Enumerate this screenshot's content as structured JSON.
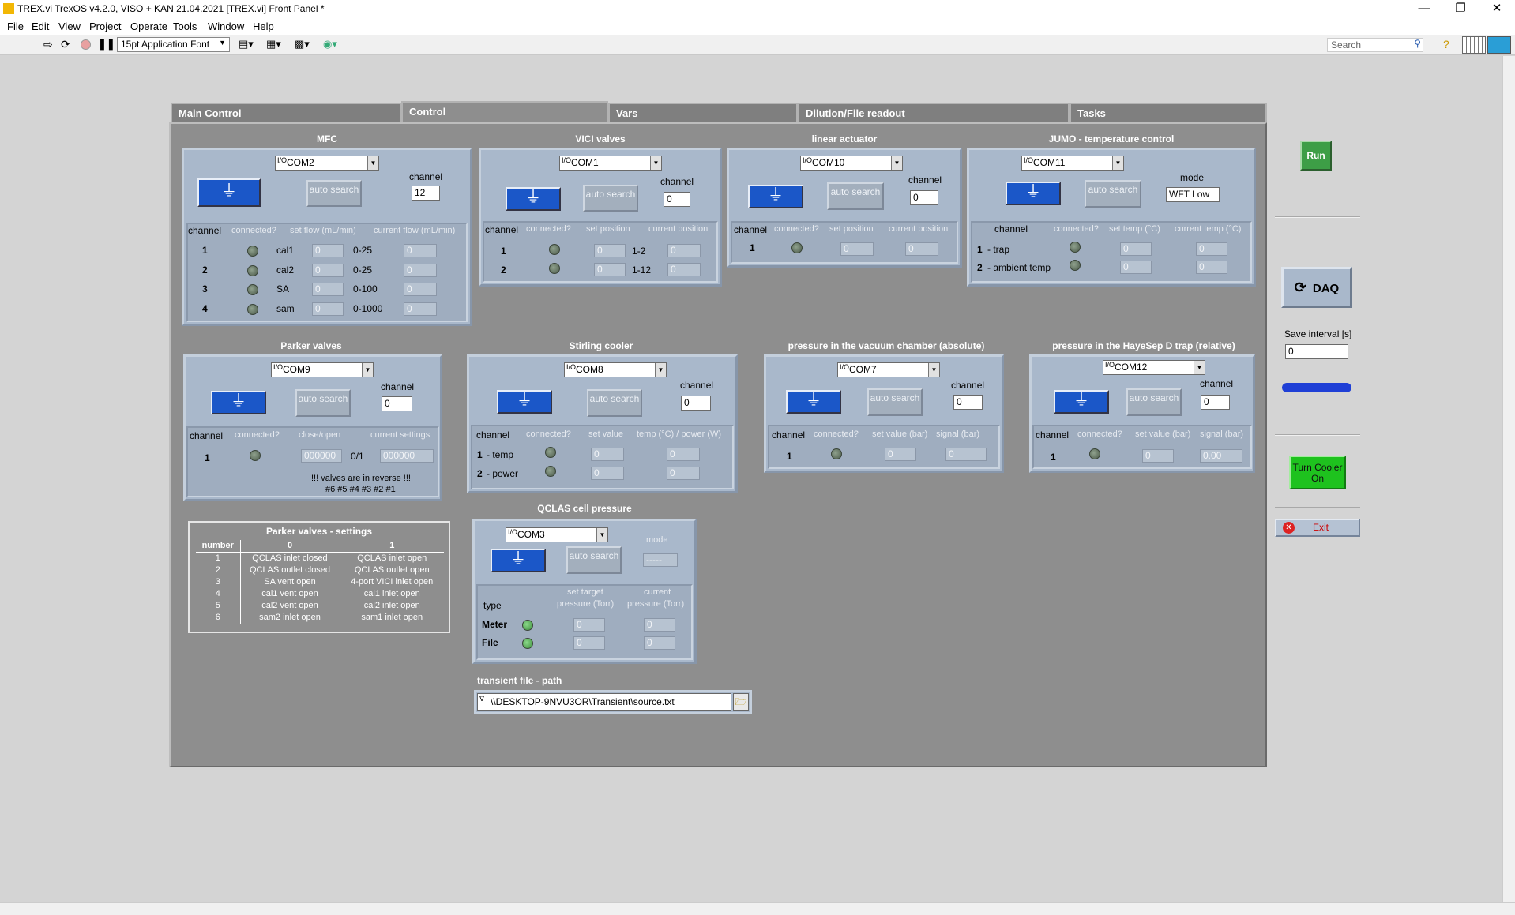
{
  "window": {
    "title": "TREX.vi TrexOS v4.2.0, VISO + KAN 21.04.2021 [TREX.vi] Front Panel *"
  },
  "menu": [
    "File",
    "Edit",
    "View",
    "Project",
    "Operate",
    "Tools",
    "Window",
    "Help"
  ],
  "toolbar": {
    "font": "15pt Application Font",
    "search_placeholder": "Search"
  },
  "tabs": [
    "Main Control",
    "Control",
    "Vars",
    "Dilution/File readout",
    "Tasks"
  ],
  "common": {
    "auto_search": "auto search",
    "channel": "channel",
    "connected": "connected?",
    "mode": "mode",
    "type": "type"
  },
  "mfc": {
    "title": "MFC",
    "port": "COM2",
    "channel_value": "12",
    "hdr_set": "set flow (mL/min)",
    "hdr_cur": "current flow (mL/min)",
    "rows": [
      {
        "ch": "1",
        "name": "cal1",
        "set": "0",
        "range": "0-25",
        "cur": "0"
      },
      {
        "ch": "2",
        "name": "cal2",
        "set": "0",
        "range": "0-25",
        "cur": "0"
      },
      {
        "ch": "3",
        "name": "SA",
        "set": "0",
        "range": "0-100",
        "cur": "0"
      },
      {
        "ch": "4",
        "name": "sam",
        "set": "0",
        "range": "0-1000",
        "cur": "0"
      }
    ]
  },
  "vici": {
    "title": "VICI valves",
    "port": "COM1",
    "channel_value": "0",
    "hdr_set": "set position",
    "hdr_cur": "current position",
    "rows": [
      {
        "ch": "1",
        "set": "0",
        "range": "1-2",
        "cur": "0"
      },
      {
        "ch": "2",
        "set": "0",
        "range": "1-12",
        "cur": "0"
      }
    ]
  },
  "actuator": {
    "title": "linear actuator",
    "port": "COM10",
    "channel_value": "0",
    "hdr_set": "set position",
    "hdr_cur": "current position",
    "rows": [
      {
        "ch": "1",
        "set": "0",
        "cur": "0"
      }
    ]
  },
  "jumo": {
    "title": "JUMO - temperature control",
    "port": "COM11",
    "mode_value": "WFT Low",
    "hdr_set": "set temp (°C)",
    "hdr_cur": "current temp (°C)",
    "rows": [
      {
        "ch": "1",
        "name": "- trap",
        "set": "0",
        "cur": "0"
      },
      {
        "ch": "2",
        "name": "- ambient temp",
        "set": "0",
        "cur": "0"
      }
    ]
  },
  "parker": {
    "title": "Parker valves",
    "port": "COM9",
    "channel_value": "0",
    "hdr_close": "close/open",
    "hdr_cur": "current settings",
    "row": {
      "ch": "1",
      "value": "000000",
      "range": "0/1",
      "cur": "000000"
    },
    "note1": "!!! valves are in reverse !!!",
    "note2": "#6 #5 #4 #3 #2 #1"
  },
  "stirling": {
    "title": "Stirling cooler",
    "port": "COM8",
    "channel_value": "0",
    "hdr_set": "set value",
    "hdr_cur": "temp (°C) / power (W)",
    "rows": [
      {
        "ch": "1",
        "name": "- temp",
        "set": "0",
        "cur": "0"
      },
      {
        "ch": "2",
        "name": "- power",
        "set": "0",
        "cur": "0"
      }
    ]
  },
  "vacuum": {
    "title": "pressure in the vacuum chamber (absolute)",
    "port": "COM7",
    "channel_value": "0",
    "hdr_set": "set value (bar)",
    "hdr_cur": "signal (bar)",
    "row": {
      "ch": "1",
      "set": "0",
      "cur": "0"
    }
  },
  "hayesep": {
    "title": "pressure in the HayeSep D trap (relative)",
    "port": "COM12",
    "channel_value": "0",
    "hdr_set": "set value (bar)",
    "hdr_cur": "signal (bar)",
    "row": {
      "ch": "1",
      "set": "0",
      "cur": "0.00"
    }
  },
  "qclas": {
    "title": "QCLAS cell pressure",
    "port": "COM3",
    "mode_value": "-----",
    "hdr_set": "set target pressure (Torr)",
    "hdr_cur": "current pressure (Torr)",
    "rows": [
      {
        "name": "Meter",
        "set": "0",
        "cur": "0"
      },
      {
        "name": "File",
        "set": "0",
        "cur": "0"
      }
    ]
  },
  "transient": {
    "label": "transient file - path",
    "value": "\\\\DESKTOP-9NVU3OR\\Transient\\source.txt"
  },
  "parker_table": {
    "title": "Parker valves - settings",
    "headers": [
      "number",
      "0",
      "1"
    ],
    "rows": [
      [
        "1",
        "QCLAS inlet closed",
        "QCLAS inlet open"
      ],
      [
        "2",
        "QCLAS outlet closed",
        "QCLAS outlet open"
      ],
      [
        "3",
        "SA vent open",
        "4-port VICI inlet open"
      ],
      [
        "4",
        "cal1 vent open",
        "cal1 inlet open"
      ],
      [
        "5",
        "cal2 vent open",
        "cal2 inlet open"
      ],
      [
        "6",
        "sam2 inlet open",
        "sam1 inlet open"
      ]
    ]
  },
  "side": {
    "run": "Run",
    "daq": "DAQ",
    "save_interval_label": "Save interval [s]",
    "save_interval": "0",
    "progress": 1.0,
    "cooler": "Turn Cooler On",
    "exit": "Exit"
  },
  "colors": {
    "panel_bg": "#8e8e8e",
    "cluster_bg": "#a9b8cb",
    "run_green": "#3d9e46",
    "cooler_green": "#1ec21e",
    "progress_blue": "#1f3fd6"
  }
}
